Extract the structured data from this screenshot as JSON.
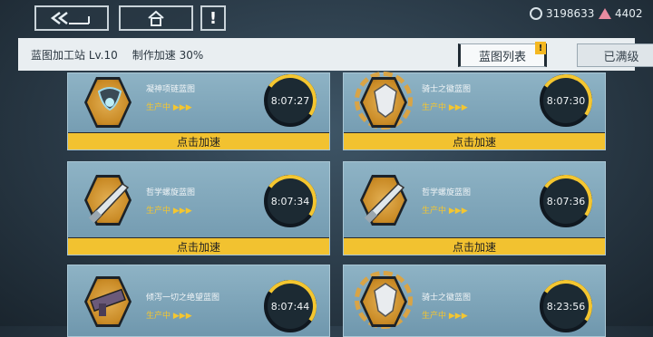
{
  "top": {
    "back_icon": "double-chevron-left-icon",
    "home_icon": "house-icon",
    "alert_label": "!",
    "currency_amount": "3198633",
    "gem_amount": "4402"
  },
  "header": {
    "station": "蓝图加工站 Lv.10",
    "speed": "制作加速 30%",
    "tabs": [
      "蓝图列表",
      "已满级"
    ],
    "tab_badge": "!"
  },
  "cards": [
    {
      "name": "凝神项链蓝图",
      "status": "生产中 ▶▶▶",
      "timer": "8:07:27",
      "action": "点击加速"
    },
    {
      "name": "骑士之徽蓝图",
      "status": "生产中 ▶▶▶",
      "timer": "8:07:30",
      "action": "点击加速"
    },
    {
      "name": "哲学螺旋蓝图",
      "status": "生产中 ▶▶▶",
      "timer": "8:07:34",
      "action": "点击加速"
    },
    {
      "name": "哲学螺旋蓝图",
      "status": "生产中 ▶▶▶",
      "timer": "8:07:36",
      "action": "点击加速"
    },
    {
      "name": "倾泻一切之绝望蓝图",
      "status": "生产中 ▶▶▶",
      "timer": "8:07:44",
      "action": ""
    },
    {
      "name": "骑士之徽蓝图",
      "status": "生产中 ▶▶▶",
      "timer": "8:23:56",
      "action": ""
    }
  ],
  "colors": {
    "accent": "#f2c230",
    "panel": "#7ea5b9",
    "header_bg": "#e9eef1"
  }
}
